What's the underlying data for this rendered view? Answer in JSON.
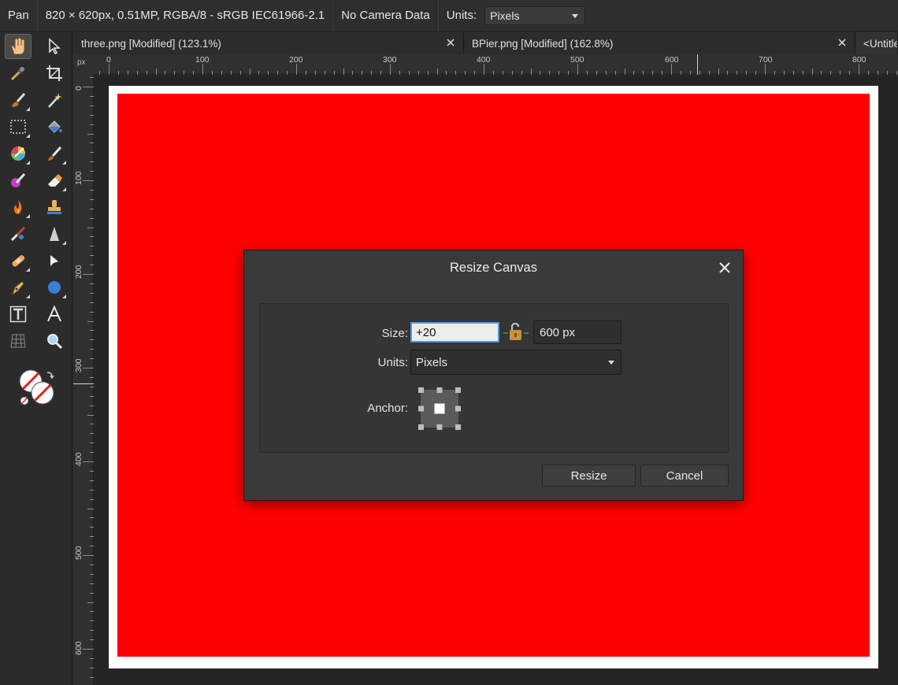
{
  "context_bar": {
    "tool_name": "Pan",
    "doc_info": "820 × 620px, 0.51MP, RGBA/8 - sRGB IEC61966-2.1",
    "camera": "No Camera Data",
    "units_label": "Units:",
    "units_value": "Pixels"
  },
  "tabs": [
    {
      "label": "three.png [Modified] (123.1%)"
    },
    {
      "label": "BPier.png [Modified] (162.8%)"
    },
    {
      "label": "<Untitle"
    }
  ],
  "ruler": {
    "unit": "px",
    "h_labels": [
      "0",
      "100",
      "200",
      "300",
      "400",
      "500",
      "600",
      "700",
      "800"
    ],
    "v_labels": [
      "0",
      "100",
      "200",
      "300",
      "400",
      "500",
      "600"
    ]
  },
  "canvas": {
    "fill_color": "#ff0000",
    "border_color": "#ffffff"
  },
  "dialog": {
    "title": "Resize Canvas",
    "size_label": "Size:",
    "width_value": "+20",
    "height_value": "600 px",
    "units_label": "Units:",
    "units_value": "Pixels",
    "anchor_label": "Anchor:",
    "resize_button": "Resize",
    "cancel_button": "Cancel"
  },
  "tools": [
    {
      "icon": "hand-pan-icon"
    },
    {
      "icon": "move-pointer-icon"
    },
    {
      "icon": "color-picker-icon"
    },
    {
      "icon": "crop-icon"
    },
    {
      "icon": "selection-brush-icon"
    },
    {
      "icon": "magic-wand-icon"
    },
    {
      "icon": "marquee-icon"
    },
    {
      "icon": "flood-fill-icon"
    },
    {
      "icon": "gradient-icon"
    },
    {
      "icon": "paint-brush-icon"
    },
    {
      "icon": "color-replace-icon"
    },
    {
      "icon": "eraser-icon"
    },
    {
      "icon": "dodge-burn-icon"
    },
    {
      "icon": "clone-stamp-icon"
    },
    {
      "icon": "smudge-icon"
    },
    {
      "icon": "sharpen-icon"
    },
    {
      "icon": "healing-icon"
    },
    {
      "icon": "node-pointer-icon"
    },
    {
      "icon": "pen-icon"
    },
    {
      "icon": "shape-ellipse-icon"
    },
    {
      "icon": "frame-text-icon"
    },
    {
      "icon": "artistic-text-icon"
    },
    {
      "icon": "mesh-warp-icon"
    },
    {
      "icon": "zoom-icon"
    },
    {
      "icon": "color-swatches-icon"
    }
  ]
}
